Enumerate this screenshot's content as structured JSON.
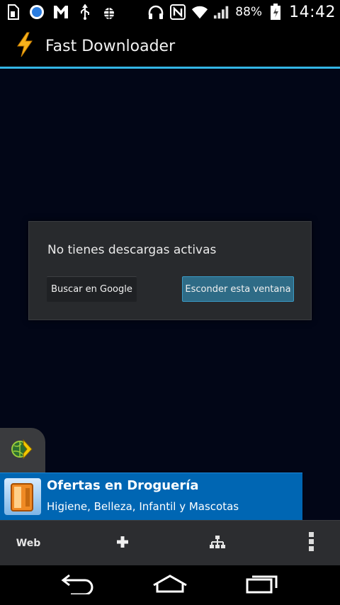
{
  "status_bar": {
    "battery_percent": "88%",
    "time": "14:42",
    "icons": [
      "sd-card-icon",
      "chrome-icon",
      "gmail-icon",
      "usb-icon",
      "android-debug-icon",
      "headphones-icon",
      "nfc-icon",
      "wifi-icon",
      "signal-icon",
      "battery-charging-icon"
    ]
  },
  "action_bar": {
    "title": "Fast Downloader",
    "accent_color": "#33b5e5",
    "app_icon": "lightning-bolt-icon"
  },
  "dialog": {
    "message": "No tienes descargas activas",
    "buttons": {
      "google": "Buscar en Google",
      "hide": "Esconder esta ventana"
    }
  },
  "ad": {
    "title": "Ofertas en Droguería",
    "subtitle": "Higiene, Belleza, Infantil y Mascotas",
    "background_color": "#0066b3"
  },
  "toolbar": {
    "web_label": "Web",
    "icons": [
      "plus-icon",
      "sitemap-icon",
      "overflow-menu-icon"
    ]
  },
  "nav_bar": {
    "icons": [
      "back-icon",
      "home-icon",
      "recent-apps-icon"
    ]
  }
}
